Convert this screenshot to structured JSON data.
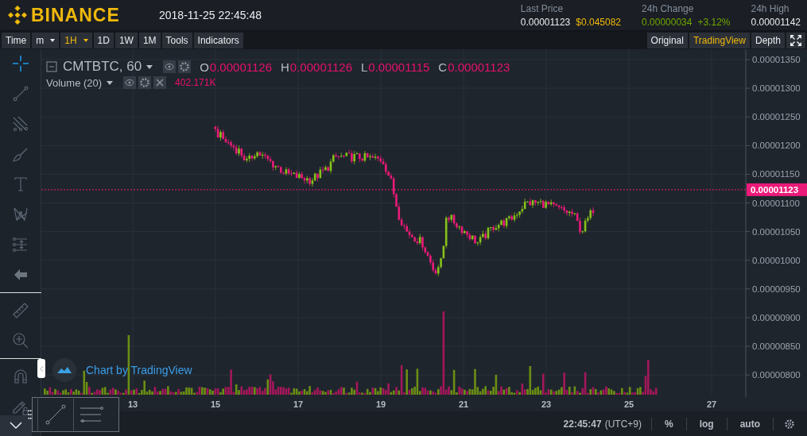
{
  "header": {
    "logo": "BINANCE",
    "datetime": "2018-11-25 22:45:48",
    "stats": [
      {
        "label": "Last Price",
        "value": "0.00001123",
        "extra": "$0.045082",
        "kind": "price"
      },
      {
        "label": "24h Change",
        "value": "0.00000034",
        "extra": "+3.12%",
        "kind": "change"
      },
      {
        "label": "24h High",
        "value": "0.00001142",
        "kind": "plain"
      }
    ]
  },
  "toolbar": {
    "items": [
      {
        "label": "Time",
        "dropdown": false,
        "selected": false
      },
      {
        "label": "m",
        "dropdown": true,
        "selected": false
      },
      {
        "label": "1H",
        "dropdown": true,
        "selected": true
      },
      {
        "label": "1D",
        "dropdown": false,
        "selected": false
      },
      {
        "label": "1W",
        "dropdown": false,
        "selected": false
      },
      {
        "label": "1M",
        "dropdown": false,
        "selected": false
      },
      {
        "label": "Tools",
        "dropdown": false,
        "selected": false
      },
      {
        "label": "Indicators",
        "dropdown": false,
        "selected": false
      }
    ],
    "views": [
      {
        "label": "Original",
        "selected": false
      },
      {
        "label": "TradingView",
        "selected": true
      },
      {
        "label": "Depth",
        "selected": false
      }
    ]
  },
  "legend": {
    "symbol": "CMTBTC, 60",
    "ohlc": [
      {
        "key": "O",
        "value": "0.00001126"
      },
      {
        "key": "H",
        "value": "0.00001126"
      },
      {
        "key": "L",
        "value": "0.00001115"
      },
      {
        "key": "C",
        "value": "0.00001123"
      }
    ],
    "volume_label": "Volume (20)",
    "volume_value": "402.171K"
  },
  "attribution": "Chart by TradingView",
  "price_axis": {
    "ticks": [
      "0.00001350",
      "0.00001300",
      "0.00001250",
      "0.00001200",
      "0.00001150",
      "0.00001100",
      "0.00001050",
      "0.00001000",
      "0.00000950",
      "0.00000900",
      "0.00000850",
      "0.00000800"
    ],
    "current": "0.00001123"
  },
  "time_axis": {
    "ticks": [
      "13",
      "15",
      "17",
      "19",
      "21",
      "23",
      "25",
      "27"
    ]
  },
  "status_bar": {
    "time": "22:45:47",
    "timezone": "(UTC+9)",
    "buttons": [
      "%",
      "log",
      "auto"
    ]
  }
}
